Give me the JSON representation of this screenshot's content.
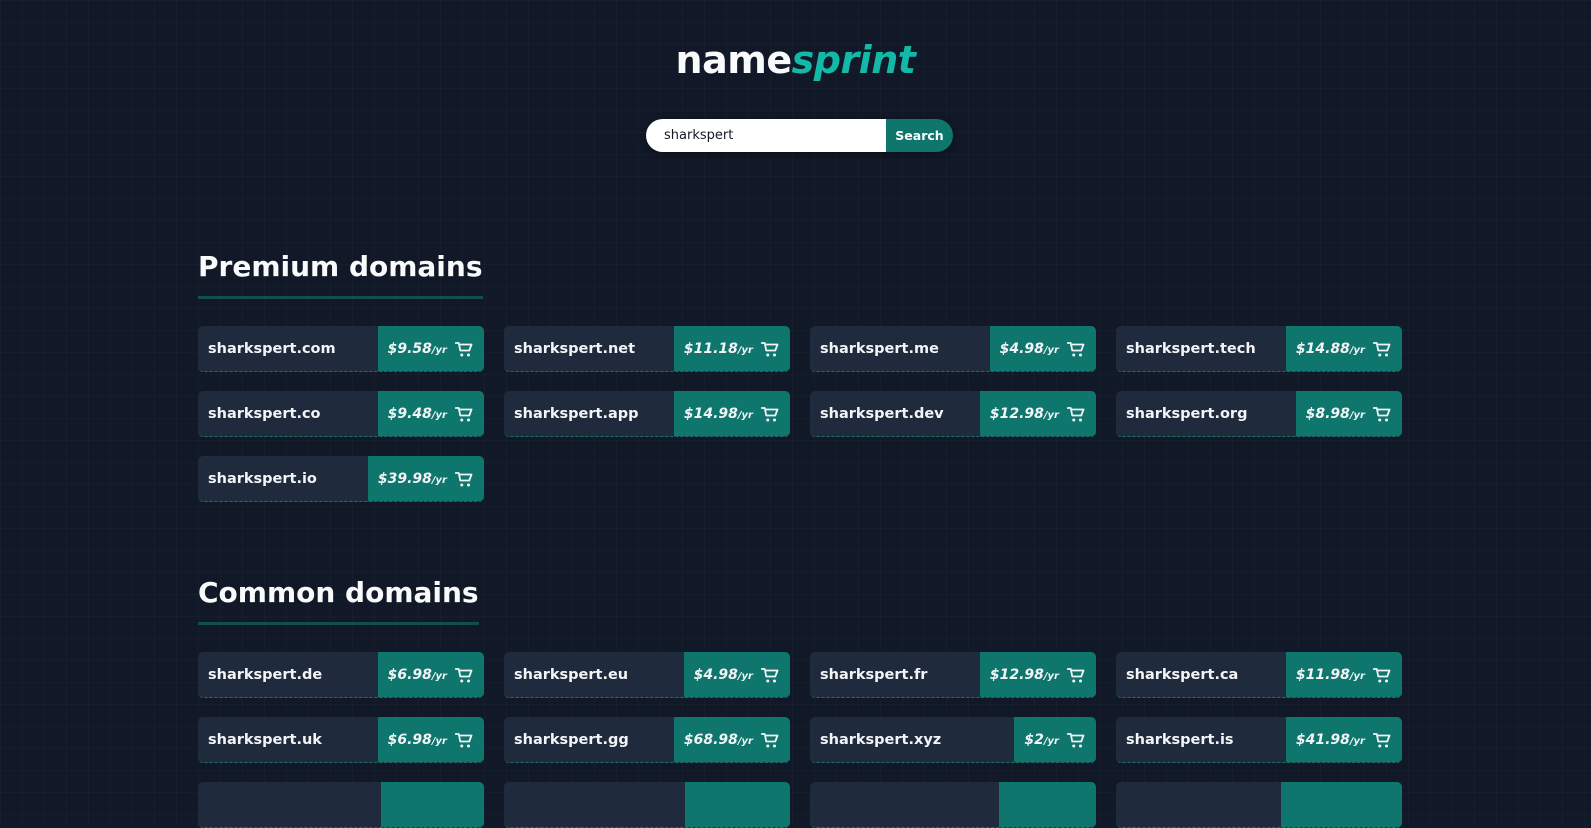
{
  "logo": {
    "name": "name",
    "sprint": "sprint"
  },
  "search": {
    "value": "sharkspert",
    "button_label": "Search"
  },
  "premium": {
    "title": "Premium domains",
    "items": [
      {
        "domain": "sharkspert.com",
        "price": "$9.58",
        "unit": "/yr"
      },
      {
        "domain": "sharkspert.net",
        "price": "$11.18",
        "unit": "/yr"
      },
      {
        "domain": "sharkspert.me",
        "price": "$4.98",
        "unit": "/yr"
      },
      {
        "domain": "sharkspert.tech",
        "price": "$14.88",
        "unit": "/yr"
      },
      {
        "domain": "sharkspert.co",
        "price": "$9.48",
        "unit": "/yr"
      },
      {
        "domain": "sharkspert.app",
        "price": "$14.98",
        "unit": "/yr"
      },
      {
        "domain": "sharkspert.dev",
        "price": "$12.98",
        "unit": "/yr"
      },
      {
        "domain": "sharkspert.org",
        "price": "$8.98",
        "unit": "/yr"
      },
      {
        "domain": "sharkspert.io",
        "price": "$39.98",
        "unit": "/yr"
      }
    ]
  },
  "common": {
    "title": "Common domains",
    "items": [
      {
        "domain": "sharkspert.de",
        "price": "$6.98",
        "unit": "/yr"
      },
      {
        "domain": "sharkspert.eu",
        "price": "$4.98",
        "unit": "/yr"
      },
      {
        "domain": "sharkspert.fr",
        "price": "$12.98",
        "unit": "/yr"
      },
      {
        "domain": "sharkspert.ca",
        "price": "$11.98",
        "unit": "/yr"
      },
      {
        "domain": "sharkspert.uk",
        "price": "$6.98",
        "unit": "/yr"
      },
      {
        "domain": "sharkspert.gg",
        "price": "$68.98",
        "unit": "/yr"
      },
      {
        "domain": "sharkspert.xyz",
        "price": "$2",
        "unit": "/yr"
      },
      {
        "domain": "sharkspert.is",
        "price": "$41.98",
        "unit": "/yr"
      }
    ]
  },
  "icons": {
    "cart": "cart-icon"
  },
  "colors": {
    "background": "#111827",
    "accent": "#0f766e",
    "logo_accent": "#14b8a6",
    "card": "#1f2a3c"
  }
}
